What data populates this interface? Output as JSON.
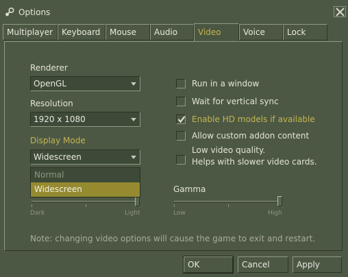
{
  "window": {
    "title": "Options"
  },
  "tabs": [
    {
      "label": "Multiplayer"
    },
    {
      "label": "Keyboard"
    },
    {
      "label": "Mouse"
    },
    {
      "label": "Audio"
    },
    {
      "label": "Video",
      "active": true
    },
    {
      "label": "Voice"
    },
    {
      "label": "Lock"
    }
  ],
  "video": {
    "renderer": {
      "label": "Renderer",
      "value": "OpenGL"
    },
    "resolution": {
      "label": "Resolution",
      "value": "1920 x 1080"
    },
    "display_mode": {
      "label": "Display Mode",
      "value": "Widescreen",
      "options": [
        "Normal",
        "Widescreen"
      ],
      "selected": "Widescreen"
    },
    "checkboxes": {
      "run_in_window": {
        "label": "Run in a window",
        "checked": false
      },
      "vertical_sync": {
        "label": "Wait for vertical sync",
        "checked": false
      },
      "hd_models": {
        "label": "Enable HD models if available",
        "checked": true
      },
      "custom_addon": {
        "label": "Allow custom addon content",
        "checked": false
      },
      "low_quality": {
        "label_line1": "Low video quality.",
        "label_line2": "Helps with slower video cards.",
        "checked": false
      }
    },
    "brightness": {
      "min_label": "Dark",
      "max_label": "Light",
      "value": 1.0
    },
    "gamma": {
      "label": "Gamma",
      "min_label": "Low",
      "max_label": "High",
      "value": 1.0
    },
    "note": "Note: changing video options will cause the game to exit and restart."
  },
  "buttons": {
    "ok": "OK",
    "cancel": "Cancel",
    "apply": "Apply"
  },
  "colors": {
    "background": "#4c5844",
    "accent": "#c4b550",
    "selection": "#958a30"
  }
}
